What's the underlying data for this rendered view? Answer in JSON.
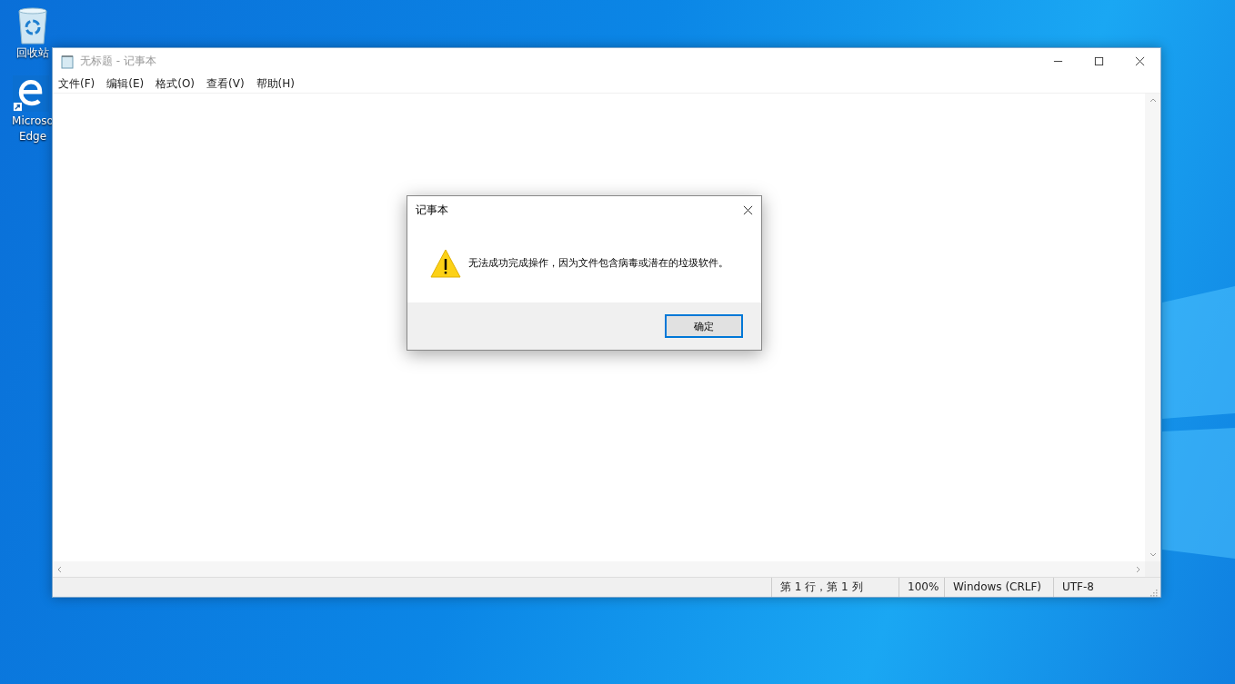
{
  "desktop_icons": [
    {
      "kind": "recycle-bin",
      "label": "回收站"
    },
    {
      "kind": "edge",
      "label": "Microso\nEdge"
    }
  ],
  "window": {
    "title": "无标题 - 记事本",
    "menu": [
      "文件(F)",
      "编辑(E)",
      "格式(O)",
      "查看(V)",
      "帮助(H)"
    ],
    "status_bar": [
      "第 1 行，第 1 列",
      "100%",
      "Windows (CRLF)",
      "UTF-8"
    ]
  },
  "dialog": {
    "title": "记事本",
    "kind": "warning",
    "message": "无法成功完成操作，因为文件包含病毒或潜在的垃圾软件。",
    "buttons": [
      "确定"
    ]
  }
}
